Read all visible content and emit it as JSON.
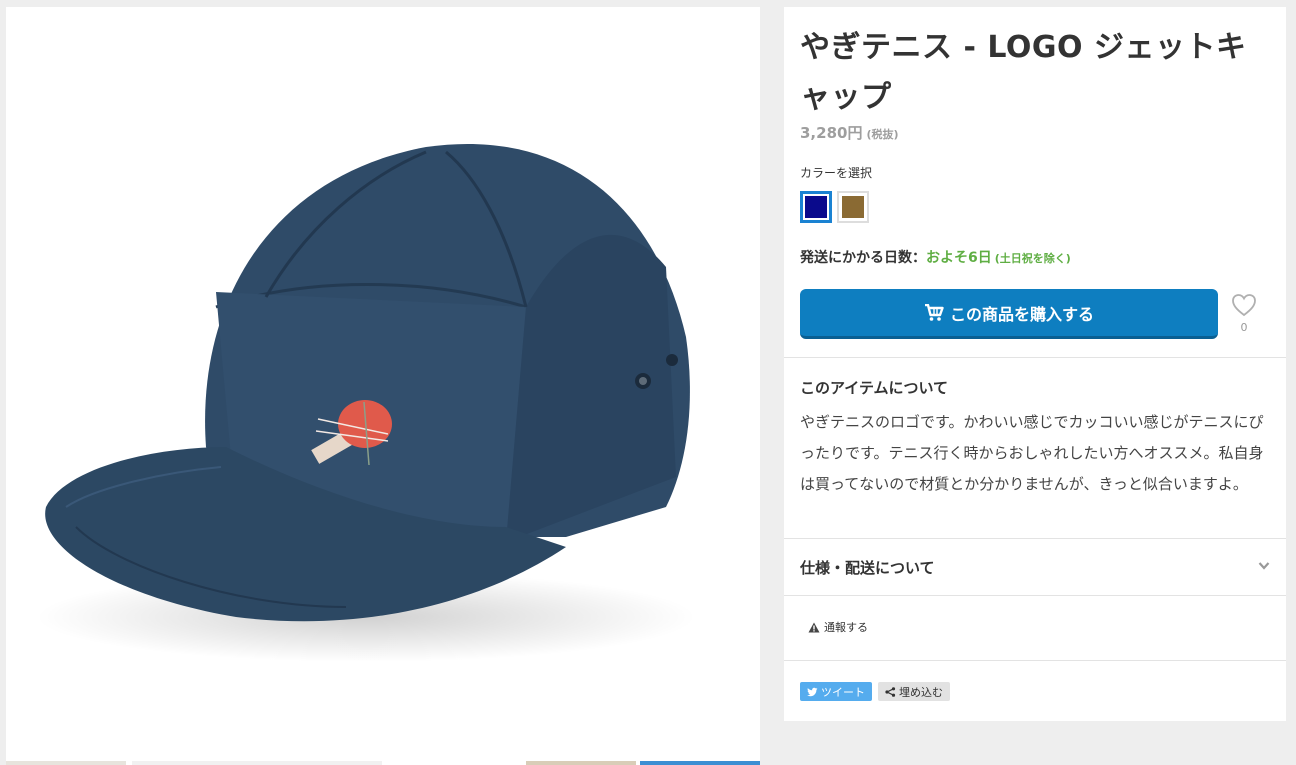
{
  "product": {
    "title": "やぎテニス - LOGO ジェットキャップ",
    "price": "3,280円",
    "tax_note": "(税抜)"
  },
  "color_selector": {
    "label": "カラーを選択",
    "options": [
      {
        "name": "navy",
        "color": "#0a0a8c",
        "selected": true
      },
      {
        "name": "brown",
        "color": "#8a6a33",
        "selected": false
      }
    ]
  },
  "shipping": {
    "label": "発送にかかる日数：",
    "days": "およそ6日",
    "note": "(土日祝を除く)"
  },
  "buy": {
    "label": "この商品を購入する",
    "icon": "cart-icon",
    "color": "#0e7ec0"
  },
  "favorite": {
    "icon": "heart-icon",
    "count": "0"
  },
  "about": {
    "title": "このアイテムについて",
    "body": "やぎテニスのロゴです。かわいい感じでカッコいい感じがテニスにぴったりです。テニス行く時からおしゃれしたい方へオススメ。私自身は買ってないので材質とか分かりませんが、きっと似合いますよ。"
  },
  "specs": {
    "title": "仕様・配送について",
    "icon": "chevron-down-icon"
  },
  "report": {
    "label": "通報する",
    "icon": "warning-icon"
  },
  "share": {
    "tweet_label": "ツイート",
    "embed_label": "埋め込む",
    "tweet_color": "#55acee"
  },
  "colors": {
    "cap": "#2d4a67",
    "logo_red": "#e05a4b",
    "ship_green": "#5fae43"
  }
}
